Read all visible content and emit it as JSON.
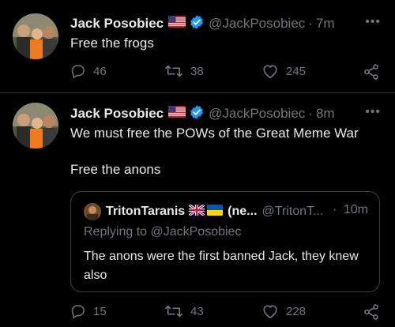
{
  "colors": {
    "background": "#000000",
    "text": "#e7e9ea",
    "muted": "#71767b",
    "verified": "#1d9bf0",
    "border": "#2f3336"
  },
  "tweets": [
    {
      "author_name": "Jack Posobiec",
      "flag_icon": "us-flag-icon",
      "verified_icon": "verified-badge-icon",
      "handle": "@JackPosobiec",
      "separator": "·",
      "time": "7m",
      "more": "•••",
      "text_lines": [
        "Free the frogs"
      ],
      "actions": {
        "replies": "46",
        "retweets": "38",
        "likes": "245"
      }
    },
    {
      "author_name": "Jack Posobiec",
      "flag_icon": "us-flag-icon",
      "verified_icon": "verified-badge-icon",
      "handle": "@JackPosobiec",
      "separator": "·",
      "time": "8m",
      "more": "•••",
      "text_lines": [
        "We must free the POWs of the Great Meme War",
        "Free the anons"
      ],
      "quoted": {
        "author_name": "TritonTaranis",
        "flags": [
          "uk-flag-icon",
          "ukraine-flag-icon"
        ],
        "name_extra": "(ne...",
        "handle": "@TritonT...",
        "separator": "·",
        "time": "10m",
        "reply_context": "Replying to @JackPosobiec",
        "text": "The anons were the first banned Jack, they knew also"
      },
      "actions": {
        "replies": "15",
        "retweets": "43",
        "likes": "228"
      }
    }
  ]
}
